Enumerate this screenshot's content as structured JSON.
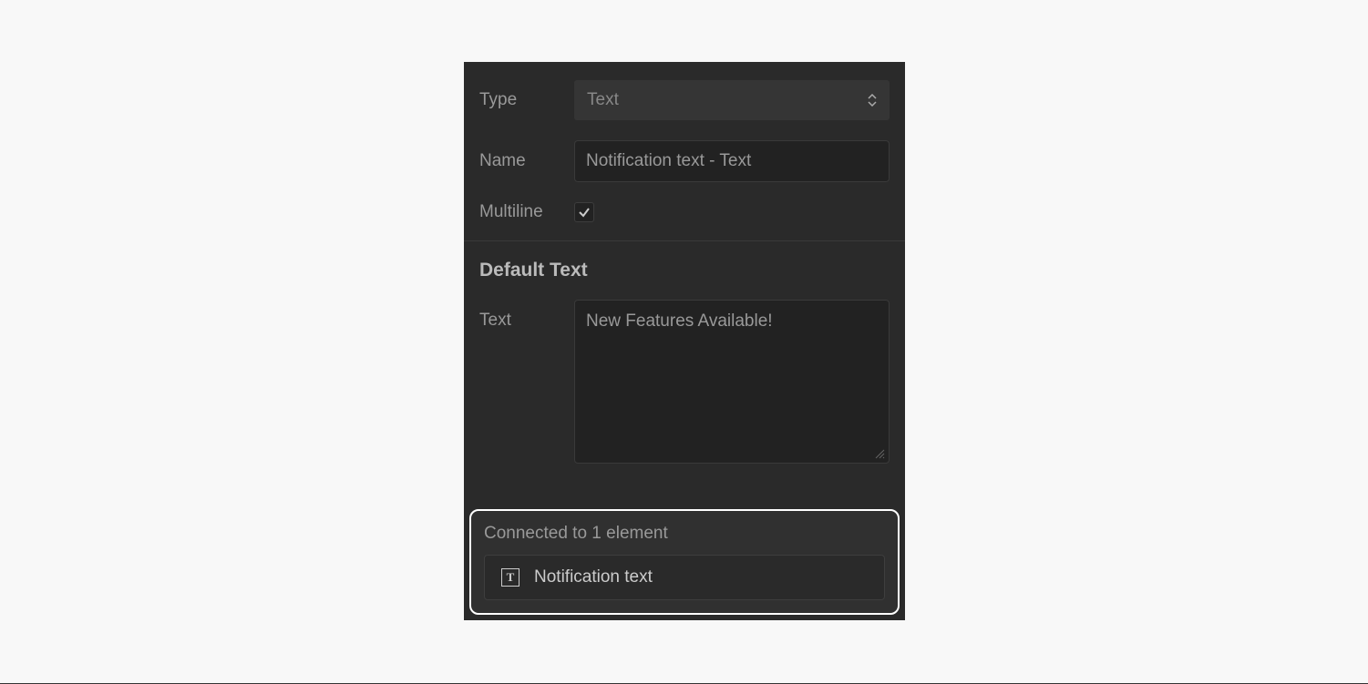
{
  "form": {
    "type_label": "Type",
    "type_value": "Text",
    "name_label": "Name",
    "name_value": "Notification text - Text",
    "multiline_label": "Multiline",
    "multiline_checked": true,
    "default_text_heading": "Default Text",
    "text_label": "Text",
    "text_value": "New Features Available!"
  },
  "connected": {
    "title": "Connected to 1 element",
    "items": [
      {
        "label": "Notification text"
      }
    ]
  }
}
